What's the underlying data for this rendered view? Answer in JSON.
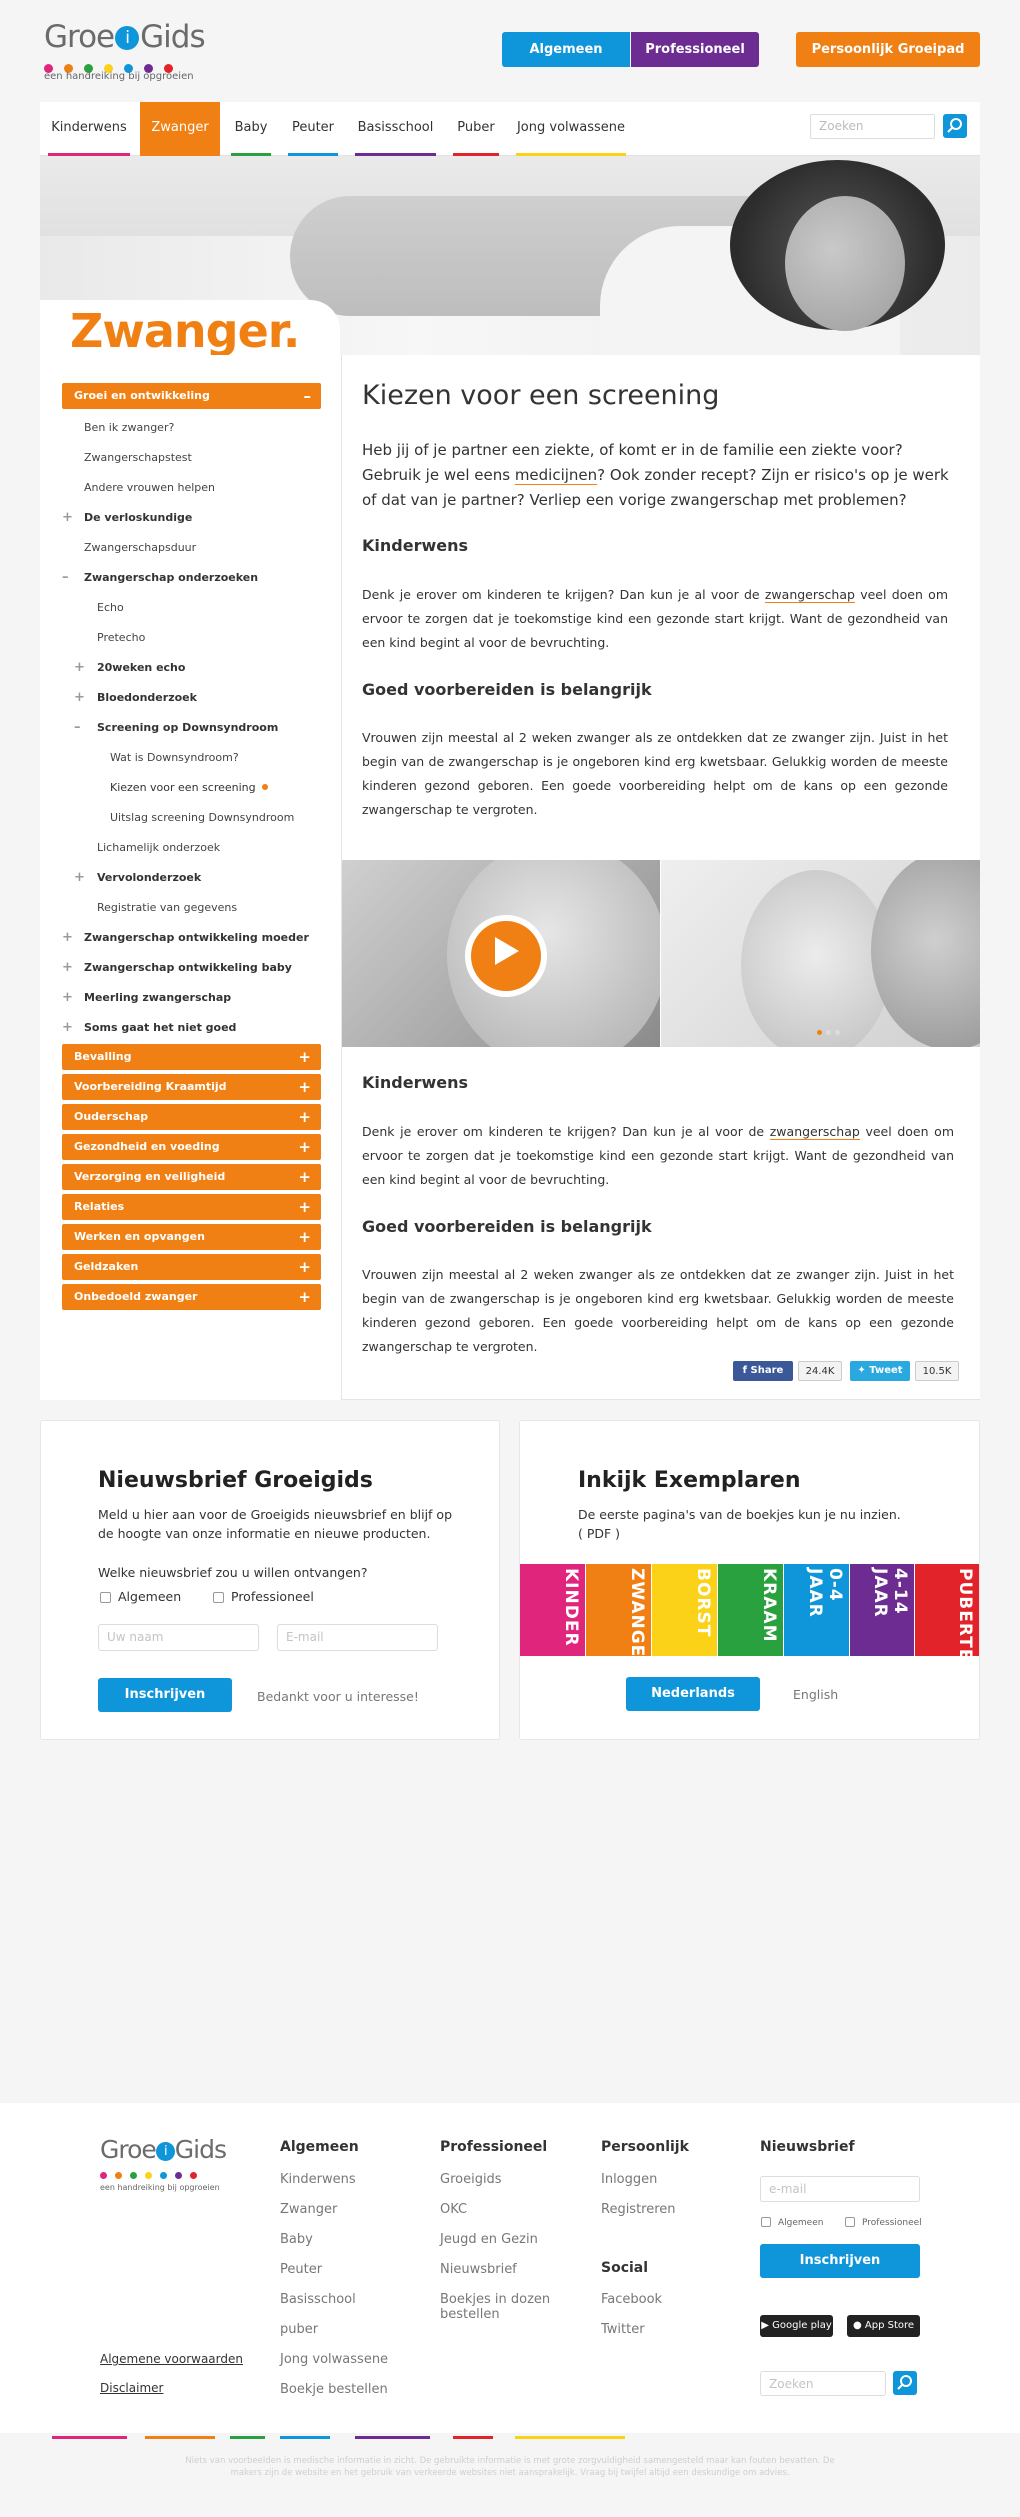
{
  "header": {
    "logo_text_1": "Groe",
    "logo_i": "i",
    "logo_text_2": "Gids",
    "logo_tagline": "een handreiking bij opgroeien",
    "logo_dot_colors": [
      "#e0257d",
      "#f08013",
      "#2aa13f",
      "#fcd219",
      "#0f95d9",
      "#6d2c91",
      "#e3232a"
    ],
    "btn_general": "Algemeen",
    "btn_professional": "Professioneel",
    "btn_personal": "Persoonlijk Groeipad"
  },
  "nav": {
    "items": [
      {
        "label": "Kinderwens",
        "color": "#e0257d"
      },
      {
        "label": "Zwanger",
        "color": "#f08013"
      },
      {
        "label": "Baby",
        "color": "#2aa13f"
      },
      {
        "label": "Peuter",
        "color": "#0f95d9"
      },
      {
        "label": "Basisschool",
        "color": "#6d2c91"
      },
      {
        "label": "Puber",
        "color": "#e3232a"
      },
      {
        "label": "Jong volwassene",
        "color": "#fcd219"
      }
    ],
    "search_placeholder": "Zoeken"
  },
  "hero": {
    "title": "Zwanger."
  },
  "sidebar": {
    "section_open": {
      "label": "Groei en ontwikkeling",
      "sign": "–"
    },
    "items": [
      {
        "label": "Ben ik zwanger?"
      },
      {
        "label": "Zwangerschapstest"
      },
      {
        "label": "Andere vrouwen helpen"
      },
      {
        "label": "De verloskundige",
        "sign": "+"
      },
      {
        "label": "Zwangerschapsduur"
      },
      {
        "label": "Zwangerschap onderzoeken",
        "sign": "–"
      },
      {
        "label": "Echo"
      },
      {
        "label": "Pretecho"
      },
      {
        "label": "20weken echo",
        "sign": "+"
      },
      {
        "label": "Bloedonderzoek",
        "sign": "+"
      },
      {
        "label": "Screening op Downsyndroom",
        "sign": "–"
      },
      {
        "label": "Wat is Downsyndroom?"
      },
      {
        "label": "Kiezen voor een screening"
      },
      {
        "label": "Uitslag screening Downsyndroom"
      },
      {
        "label": "Lichamelijk onderzoek"
      },
      {
        "label": "Vervolonderzoek",
        "sign": "+"
      },
      {
        "label": "Registratie van gegevens"
      },
      {
        "label": "Zwangerschap ontwikkeling moeder",
        "sign": "+"
      },
      {
        "label": "Zwangerschap ontwikkeling baby",
        "sign": "+"
      },
      {
        "label": "Meerling zwangerschap",
        "sign": "+"
      },
      {
        "label": "Soms gaat het niet goed",
        "sign": "+"
      }
    ],
    "orange": [
      {
        "label": "Bevalling",
        "sign": "+"
      },
      {
        "label": "Voorbereiding Kraamtijd",
        "sign": "+"
      },
      {
        "label": "Ouderschap",
        "sign": "+"
      },
      {
        "label": "Gezondheid en voeding",
        "sign": "+"
      },
      {
        "label": "Verzorging en veiligheid",
        "sign": "+"
      },
      {
        "label": "Relaties",
        "sign": "+"
      },
      {
        "label": "Werken en opvangen",
        "sign": "+"
      },
      {
        "label": "Geldzaken",
        "sign": "+"
      },
      {
        "label": "Onbedoeld zwanger",
        "sign": "+"
      }
    ]
  },
  "article": {
    "title": "Kiezen voor een screening",
    "lead_1": "Heb jij of je partner een ziekte, of komt er in de familie een ziekte voor? Gebruik je wel eens ",
    "lead_link": "medicijnen",
    "lead_2": "? Ook zonder recept? Zijn er risico's op je werk of dat van je partner? Verliep een vorige zwangerschap met problemen?",
    "h_kinderwens": "Kinderwens",
    "p_kinderwens_1": "Denk je erover om kinderen te krijgen? Dan kun je al voor de ",
    "p_kinderwens_link": "zwangerschap",
    "p_kinderwens_2": " veel doen om ervoor te zorgen dat je toekomstige kind een gezonde start krijgt. Want de gezondheid van een kind begint al voor de bevruchting.",
    "h_voorbereiden": "Goed voorbereiden is belangrijk",
    "p_voorbereiden": "Vrouwen zijn meestal al 2 weken zwanger als ze ontdekken dat ze zwanger zijn. Juist in het begin van de zwangerschap is je ongeboren kind erg kwetsbaar. Gelukkig worden de meeste kinderen gezond geboren. Een goede voorbereiding helpt om de kans op een gezonde zwangerschap te vergroten.",
    "slider_dot_colors": [
      "#f08013",
      "#cccccc",
      "#cccccc"
    ],
    "share_fb": "Share",
    "share_fb_count": "24.4K",
    "share_tw": "Tweet",
    "share_tw_count": "10.5K"
  },
  "newsletter": {
    "title": "Nieuwsbrief Groeigids",
    "text": "Meld u hier aan voor de Groeigids nieuwsbrief en blijf op de hoogte van onze informatie en nieuwe producten.",
    "question": "Welke nieuwsbrief zou u willen ontvangen?",
    "opt1": "Algemeen",
    "opt2": "Professioneel",
    "name_placeholder": "Uw naam",
    "email_placeholder": "E-mail",
    "submit": "Inschrijven",
    "thanks": "Bedankt voor u interesse!"
  },
  "inkijk": {
    "title": "Inkijk Exemplaren",
    "text_1": "De eerste pagina's van de boekjes kun je nu inzien.",
    "text_2": "( PDF )",
    "covers": [
      {
        "label": "KINDER",
        "color": "#e0257d"
      },
      {
        "label": "ZWANGER",
        "color": "#f08013"
      },
      {
        "label": "BORST",
        "color": "#fcd219"
      },
      {
        "label": "KRAAM",
        "color": "#2aa13f"
      },
      {
        "label": "0-4 JAAR",
        "color": "#0f95d9"
      },
      {
        "label": "4-14 JAAR",
        "color": "#6d2c91"
      },
      {
        "label": "PUBERTEIT",
        "color": "#e3232a"
      }
    ],
    "btn_nl": "Nederlands",
    "btn_en": "English"
  },
  "footer": {
    "col1_title": "Algemeen",
    "col1": [
      "Kinderwens",
      "Zwanger",
      "Baby",
      "Peuter",
      "Basisschool",
      "puber",
      "Jong volwassene",
      "Boekje bestellen"
    ],
    "col2_title": "Professioneel",
    "col2": [
      "Groeigids",
      "OKC",
      "Jeugd en Gezin",
      "Nieuwsbrief",
      "Boekjes in dozen bestellen"
    ],
    "col3_title": "Persoonlijk",
    "col3": [
      "Inloggen",
      "Registreren"
    ],
    "social_title": "Social",
    "social": [
      "Facebook",
      "Twitter"
    ],
    "nl_title": "Nieuwsbrief",
    "nl_placeholder": "e-mail",
    "nl_opt1": "Algemeen",
    "nl_opt2": "Professioneel",
    "nl_submit": "Inschrijven",
    "google_play": "Google play",
    "app_store": "App Store",
    "search_placeholder": "Zoeken",
    "terms": "Algemene voorwaarden",
    "disclaimer": "Disclaimer",
    "legal": "Niets van voorbeelden is medische informatie in zicht. De gebruikte informatie is met grote zorgvuldigheid samengesteld maar kan fouten bevatten. De makers zijn de website en het gebruik van verkeerde websites niet aansprakelijk. Vraag bij twijfel altijd een deskundige om advies."
  }
}
